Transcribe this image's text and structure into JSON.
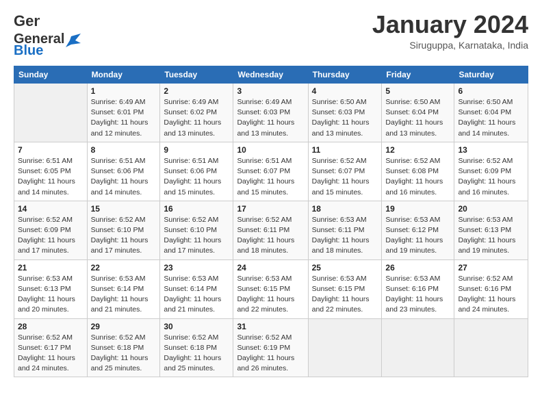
{
  "logo": {
    "part1": "General",
    "part2": "Blue"
  },
  "header": {
    "title": "January 2024",
    "location": "Siruguppa, Karnataka, India"
  },
  "weekdays": [
    "Sunday",
    "Monday",
    "Tuesday",
    "Wednesday",
    "Thursday",
    "Friday",
    "Saturday"
  ],
  "weeks": [
    [
      {
        "day": "",
        "info": ""
      },
      {
        "day": "1",
        "info": "Sunrise: 6:49 AM\nSunset: 6:01 PM\nDaylight: 11 hours\nand 12 minutes."
      },
      {
        "day": "2",
        "info": "Sunrise: 6:49 AM\nSunset: 6:02 PM\nDaylight: 11 hours\nand 13 minutes."
      },
      {
        "day": "3",
        "info": "Sunrise: 6:49 AM\nSunset: 6:03 PM\nDaylight: 11 hours\nand 13 minutes."
      },
      {
        "day": "4",
        "info": "Sunrise: 6:50 AM\nSunset: 6:03 PM\nDaylight: 11 hours\nand 13 minutes."
      },
      {
        "day": "5",
        "info": "Sunrise: 6:50 AM\nSunset: 6:04 PM\nDaylight: 11 hours\nand 13 minutes."
      },
      {
        "day": "6",
        "info": "Sunrise: 6:50 AM\nSunset: 6:04 PM\nDaylight: 11 hours\nand 14 minutes."
      }
    ],
    [
      {
        "day": "7",
        "info": "Sunrise: 6:51 AM\nSunset: 6:05 PM\nDaylight: 11 hours\nand 14 minutes."
      },
      {
        "day": "8",
        "info": "Sunrise: 6:51 AM\nSunset: 6:06 PM\nDaylight: 11 hours\nand 14 minutes."
      },
      {
        "day": "9",
        "info": "Sunrise: 6:51 AM\nSunset: 6:06 PM\nDaylight: 11 hours\nand 15 minutes."
      },
      {
        "day": "10",
        "info": "Sunrise: 6:51 AM\nSunset: 6:07 PM\nDaylight: 11 hours\nand 15 minutes."
      },
      {
        "day": "11",
        "info": "Sunrise: 6:52 AM\nSunset: 6:07 PM\nDaylight: 11 hours\nand 15 minutes."
      },
      {
        "day": "12",
        "info": "Sunrise: 6:52 AM\nSunset: 6:08 PM\nDaylight: 11 hours\nand 16 minutes."
      },
      {
        "day": "13",
        "info": "Sunrise: 6:52 AM\nSunset: 6:09 PM\nDaylight: 11 hours\nand 16 minutes."
      }
    ],
    [
      {
        "day": "14",
        "info": "Sunrise: 6:52 AM\nSunset: 6:09 PM\nDaylight: 11 hours\nand 17 minutes."
      },
      {
        "day": "15",
        "info": "Sunrise: 6:52 AM\nSunset: 6:10 PM\nDaylight: 11 hours\nand 17 minutes."
      },
      {
        "day": "16",
        "info": "Sunrise: 6:52 AM\nSunset: 6:10 PM\nDaylight: 11 hours\nand 17 minutes."
      },
      {
        "day": "17",
        "info": "Sunrise: 6:52 AM\nSunset: 6:11 PM\nDaylight: 11 hours\nand 18 minutes."
      },
      {
        "day": "18",
        "info": "Sunrise: 6:53 AM\nSunset: 6:11 PM\nDaylight: 11 hours\nand 18 minutes."
      },
      {
        "day": "19",
        "info": "Sunrise: 6:53 AM\nSunset: 6:12 PM\nDaylight: 11 hours\nand 19 minutes."
      },
      {
        "day": "20",
        "info": "Sunrise: 6:53 AM\nSunset: 6:13 PM\nDaylight: 11 hours\nand 19 minutes."
      }
    ],
    [
      {
        "day": "21",
        "info": "Sunrise: 6:53 AM\nSunset: 6:13 PM\nDaylight: 11 hours\nand 20 minutes."
      },
      {
        "day": "22",
        "info": "Sunrise: 6:53 AM\nSunset: 6:14 PM\nDaylight: 11 hours\nand 21 minutes."
      },
      {
        "day": "23",
        "info": "Sunrise: 6:53 AM\nSunset: 6:14 PM\nDaylight: 11 hours\nand 21 minutes."
      },
      {
        "day": "24",
        "info": "Sunrise: 6:53 AM\nSunset: 6:15 PM\nDaylight: 11 hours\nand 22 minutes."
      },
      {
        "day": "25",
        "info": "Sunrise: 6:53 AM\nSunset: 6:15 PM\nDaylight: 11 hours\nand 22 minutes."
      },
      {
        "day": "26",
        "info": "Sunrise: 6:53 AM\nSunset: 6:16 PM\nDaylight: 11 hours\nand 23 minutes."
      },
      {
        "day": "27",
        "info": "Sunrise: 6:52 AM\nSunset: 6:16 PM\nDaylight: 11 hours\nand 24 minutes."
      }
    ],
    [
      {
        "day": "28",
        "info": "Sunrise: 6:52 AM\nSunset: 6:17 PM\nDaylight: 11 hours\nand 24 minutes."
      },
      {
        "day": "29",
        "info": "Sunrise: 6:52 AM\nSunset: 6:18 PM\nDaylight: 11 hours\nand 25 minutes."
      },
      {
        "day": "30",
        "info": "Sunrise: 6:52 AM\nSunset: 6:18 PM\nDaylight: 11 hours\nand 25 minutes."
      },
      {
        "day": "31",
        "info": "Sunrise: 6:52 AM\nSunset: 6:19 PM\nDaylight: 11 hours\nand 26 minutes."
      },
      {
        "day": "",
        "info": ""
      },
      {
        "day": "",
        "info": ""
      },
      {
        "day": "",
        "info": ""
      }
    ]
  ]
}
